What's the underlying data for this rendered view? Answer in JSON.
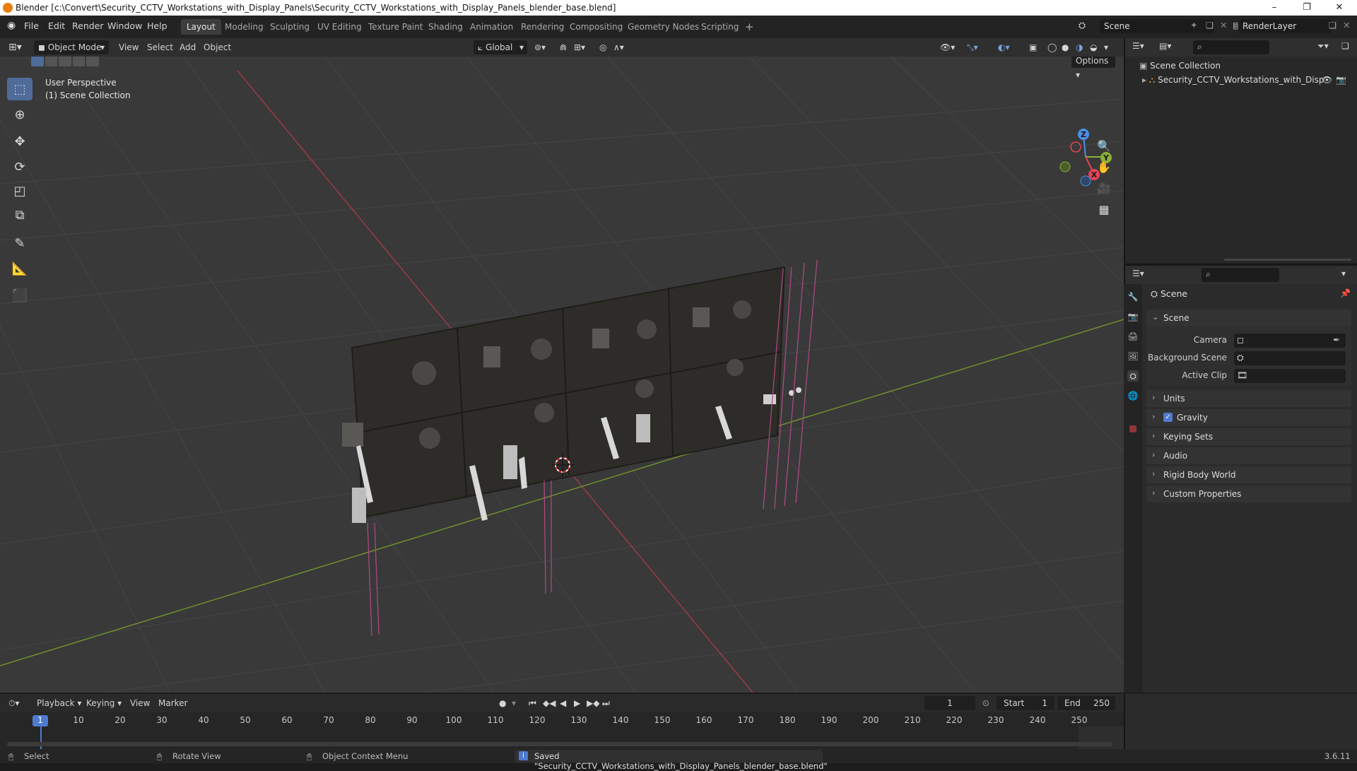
{
  "window": {
    "title": "Blender [c:\\Convert\\Security_CCTV_Workstations_with_Display_Panels\\Security_CCTV_Workstations_with_Display_Panels_blender_base.blend]",
    "minimize": "–",
    "maximize": "❐",
    "close": "✕"
  },
  "menu": [
    "File",
    "Edit",
    "Render",
    "Window",
    "Help"
  ],
  "workspaces": [
    "Layout",
    "Modeling",
    "Sculpting",
    "UV Editing",
    "Texture Paint",
    "Shading",
    "Animation",
    "Rendering",
    "Compositing",
    "Geometry Nodes",
    "Scripting"
  ],
  "workspace_add": "+",
  "scene_field": "Scene",
  "view_layer_field": "RenderLayer",
  "viewport_header": {
    "mode": "Object Mode",
    "menus": [
      "View",
      "Select",
      "Add",
      "Object"
    ],
    "transform_orientation": "Global",
    "options": "Options"
  },
  "viewport": {
    "perspective": "User Perspective",
    "collection": "(1) Scene Collection",
    "gizmo": {
      "x": "X",
      "y": "Y",
      "z": "Z"
    }
  },
  "outliner": {
    "root": "Scene Collection",
    "items": [
      {
        "label": "Security_CCTV_Workstations_with_Disp"
      }
    ]
  },
  "properties": {
    "context_label": "Scene",
    "section_scene": "Scene",
    "camera_label": "Camera",
    "background_scene_label": "Background Scene",
    "active_clip_label": "Active Clip",
    "panels": [
      "Units",
      "Gravity",
      "Keying Sets",
      "Audio",
      "Rigid Body World",
      "Custom Properties"
    ],
    "gravity_checked": true
  },
  "timeline": {
    "menus": [
      "Playback",
      "Keying",
      "View",
      "Marker"
    ],
    "current_frame": "1",
    "start_label": "Start",
    "start_value": "1",
    "end_label": "End",
    "end_value": "250",
    "ticks": [
      "1",
      "10",
      "20",
      "30",
      "40",
      "50",
      "60",
      "70",
      "80",
      "90",
      "100",
      "110",
      "120",
      "130",
      "140",
      "150",
      "160",
      "170",
      "180",
      "190",
      "200",
      "210",
      "220",
      "230",
      "240",
      "250"
    ]
  },
  "statusbar": {
    "select": "Select",
    "rotate": "Rotate View",
    "context_menu": "Object Context Menu",
    "message": "Saved \"Security_CCTV_Workstations_with_Display_Panels_blender_base.blend\"",
    "version": "3.6.11"
  }
}
